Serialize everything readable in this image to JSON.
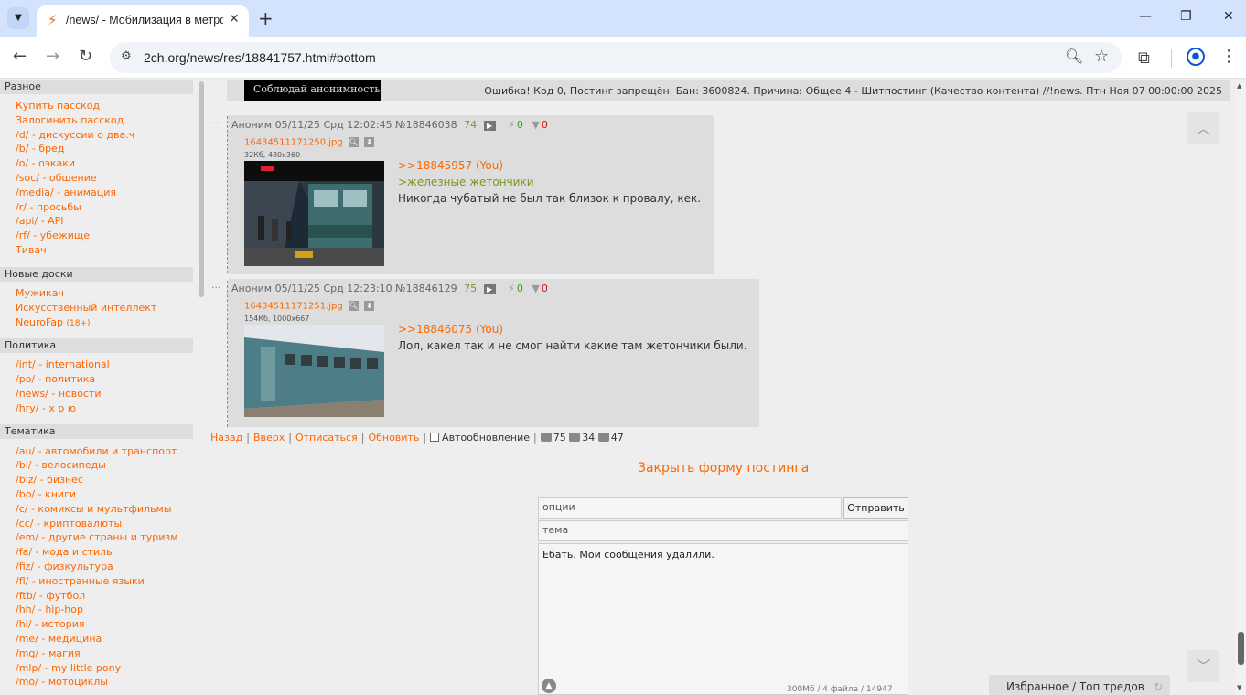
{
  "browser": {
    "tab_title": "/news/ - Мобилизация в метро",
    "url": "2ch.org/news/res/18841757.html#bottom"
  },
  "sidebar": {
    "groups": [
      {
        "title": "Разное",
        "items": [
          {
            "label": "Купить пасскод"
          },
          {
            "label": "Залогинить пасскод"
          },
          {
            "label": "/d/ - дискуссии о два.ч"
          },
          {
            "label": "/b/ - бред"
          },
          {
            "label": "/o/ - оэкаки"
          },
          {
            "label": "/soc/ - общение"
          },
          {
            "label": "/media/ - анимация"
          },
          {
            "label": "/r/ - просьбы"
          },
          {
            "label": "/api/ - API"
          },
          {
            "label": "/rf/ - убежище"
          },
          {
            "label": "Тивач"
          }
        ]
      },
      {
        "title": "Новые доски",
        "items": [
          {
            "label": "Мужикач"
          },
          {
            "label": "Искусственный интеллект"
          },
          {
            "label": "NeuroFap",
            "suffix": "(18+)"
          }
        ]
      },
      {
        "title": "Политика",
        "items": [
          {
            "label": "/int/ - international"
          },
          {
            "label": "/po/ - политика"
          },
          {
            "label": "/news/ - новости"
          },
          {
            "label": "/hry/ - х р ю"
          }
        ]
      },
      {
        "title": "Тематика",
        "items": [
          {
            "label": "/au/ - автомобили и транспорт"
          },
          {
            "label": "/bi/ - велосипеды"
          },
          {
            "label": "/biz/ - бизнес"
          },
          {
            "label": "/bo/ - книги"
          },
          {
            "label": "/c/ - комиксы и мультфильмы"
          },
          {
            "label": "/cc/ - криптовалюты"
          },
          {
            "label": "/em/ - другие страны и туризм"
          },
          {
            "label": "/fa/ - мода и стиль"
          },
          {
            "label": "/fiz/ - физкультура"
          },
          {
            "label": "/fl/ - иностранные языки"
          },
          {
            "label": "/ftb/ - футбол"
          },
          {
            "label": "/hh/ - hip-hop"
          },
          {
            "label": "/hi/ - история"
          },
          {
            "label": "/me/ - медицина"
          },
          {
            "label": "/mg/ - магия"
          },
          {
            "label": "/mlp/ - my little pony"
          },
          {
            "label": "/mo/ - мотоциклы"
          }
        ]
      }
    ]
  },
  "banner": {
    "anon_text": "Соблюдай анонимность",
    "error": "Ошибка! Код 0, Постинг запрещён. Бан: 3600824. Причина: Общее 4 - Шитпостинг (Качество контента) //!news. Птн Ноя 07 00:00:00 2025"
  },
  "posts": [
    {
      "marker": "···",
      "author": "Аноним",
      "date": "05/11/25 Срд 12:02:45",
      "number": "№18846038",
      "count": "74",
      "likes": "0",
      "dislikes": "0",
      "file_name": "16434511171250.jpg",
      "file_meta": "32Кб, 480x360",
      "reply_link": ">>18845957 (You)",
      "quote": ">железные жетончики",
      "text": "Никогда чубатый не был так близок к провалу, кек."
    },
    {
      "marker": "···",
      "author": "Аноним",
      "date": "05/11/25 Срд 12:23:10",
      "number": "№18846129",
      "count": "75",
      "likes": "0",
      "dislikes": "0",
      "file_name": "16434511171251.jpg",
      "file_meta": "154Кб, 1000x667",
      "reply_link": ">>18846075 (You)",
      "text": "Лол, какел так и не смог найти какие там жетончики были."
    }
  ],
  "thread_nav": {
    "back": "Назад",
    "top": "Вверх",
    "unsubscribe": "Отписаться",
    "refresh": "Обновить",
    "autoupdate": "Автообновление",
    "posts_count": "75",
    "files_count": "34",
    "posters_count": "47"
  },
  "form": {
    "close_label": "Закрыть форму постинга",
    "options_placeholder": "опции",
    "submit_label": "Отправить",
    "subject_placeholder": "тема",
    "message": "Ебать. Мои сообщения удалили.",
    "limits": "300Мб / 4 файла / 14947"
  },
  "floating": {
    "favorites_label": "Избранное / Топ тредов"
  },
  "colors": {
    "link": "#ff6600",
    "quote": "#789922",
    "post_bg": "#dddddd",
    "page_bg": "#eeeeee"
  }
}
